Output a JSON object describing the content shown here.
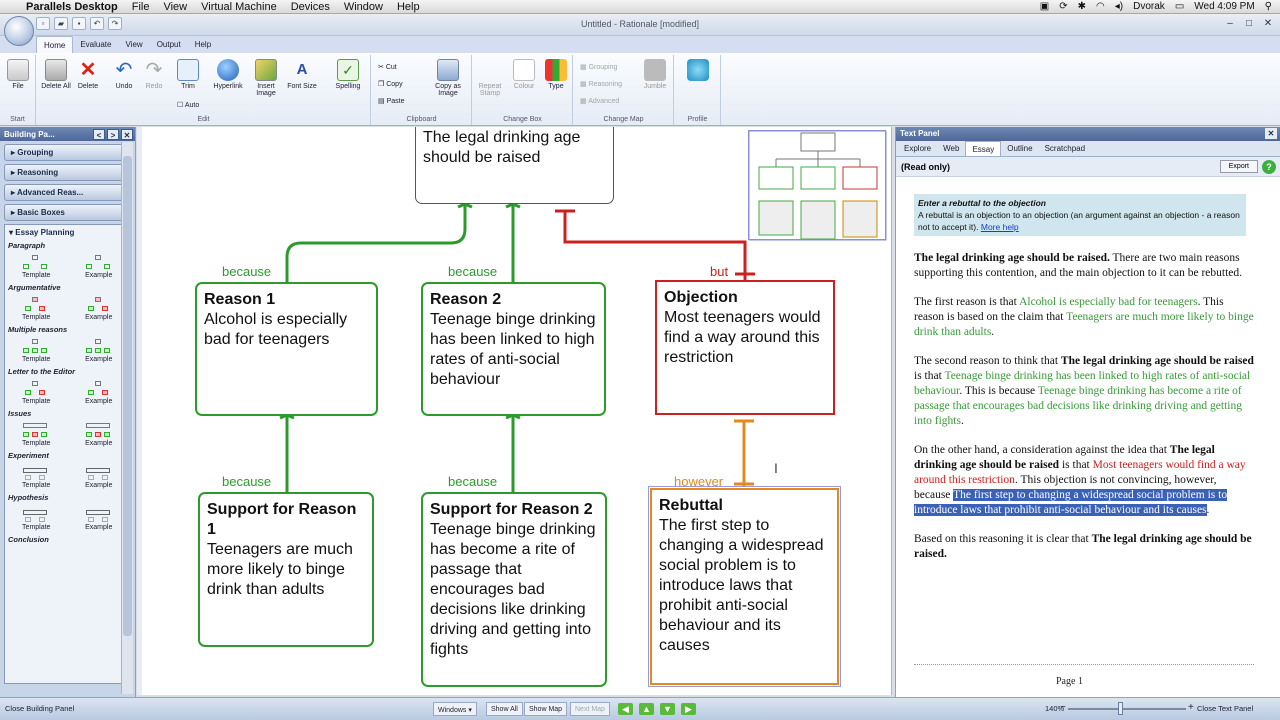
{
  "mac_menu": {
    "app": "Parallels Desktop",
    "items": [
      "File",
      "View",
      "Virtual Machine",
      "Devices",
      "Window",
      "Help"
    ],
    "user": "Dvorak",
    "clock": "Wed 4:09 PM"
  },
  "window": {
    "title": "Untitled - Rationale [modified]"
  },
  "ribbon_tabs": [
    "Home",
    "Evaluate",
    "View",
    "Output",
    "Help"
  ],
  "ribbon": {
    "start": {
      "label": "Start",
      "file": "File"
    },
    "edit": {
      "label": "Edit",
      "delete_all": "Delete All",
      "delete": "Delete",
      "undo": "Undo",
      "redo": "Redo",
      "trim": "Trim",
      "auto": "Auto",
      "hyperlink": "Hyperlink",
      "insert_image": "Insert Image",
      "font_size": "Font Size",
      "spelling": "Spelling"
    },
    "clipboard": {
      "label": "Clipboard",
      "cut": "Cut",
      "copy": "Copy",
      "paste": "Paste",
      "copy_as_image": "Copy as Image"
    },
    "change_box": {
      "label": "Change Box",
      "repeat_stamp": "Repeat Stamp",
      "colour": "Colour",
      "type": "Type"
    },
    "change_map": {
      "label": "Change Map",
      "grouping": "Grouping",
      "reasoning": "Reasoning",
      "advanced": "Advanced",
      "jumble": "Jumble"
    },
    "profile": {
      "label": "Profile"
    }
  },
  "building_panel": {
    "title": "Building Pa...",
    "categories": [
      "Grouping",
      "Reasoning",
      "Advanced Reas...",
      "Basic Boxes"
    ],
    "essay_planning": {
      "title": "Essay Planning",
      "sections": [
        "Paragraph",
        "Argumentative",
        "Multiple reasons",
        "Letter to the Editor",
        "Issues",
        "Experiment",
        "Hypothesis",
        "Conclusion"
      ],
      "template": "Template",
      "example": "Example"
    }
  },
  "map": {
    "contention": "The legal drinking age should be raised",
    "reason1": {
      "title": "Reason 1",
      "text": "Alcohol is especially bad for teenagers"
    },
    "reason2": {
      "title": "Reason 2",
      "text": "Teenage binge drinking has been linked to high rates of anti-social behaviour"
    },
    "objection": {
      "title": "Objection",
      "text": "Most teenagers would find a way around this restriction"
    },
    "support1": {
      "title": "Support for Reason 1",
      "text": "Teenagers are much more likely to binge drink than adults"
    },
    "support2": {
      "title": "Support for Reason 2",
      "text": "Teenage binge drinking has become a rite of passage that encourages bad decisions like drinking driving and getting into fights"
    },
    "rebuttal": {
      "title": "Rebuttal",
      "text": "The first step to changing a widespread social problem is to introduce laws that prohibit anti-social behaviour and its causes"
    },
    "because": "because",
    "but": "but",
    "however": "however",
    "cursor": "I"
  },
  "text_panel": {
    "title": "Text Panel",
    "tabs": [
      "Explore",
      "Web",
      "Essay",
      "Outline",
      "Scratchpad"
    ],
    "read_only": "(Read only)",
    "export": "Export",
    "help": "?",
    "hint_title": "Enter a rebuttal to the objection",
    "hint_text": "A rebuttal is an objection to an objection (an argument against an objection - a reason not to accept it).",
    "hint_link": "More help",
    "p1": {
      "c": "The legal drinking age should be raised.",
      "t": " There are two main reasons supporting this contention, and the main objection to it can be rebutted."
    },
    "p2": {
      "a": "The first reason is that ",
      "g1": "Alcohol is especially bad for teenagers",
      "b": ". This reason is based on the claim that ",
      "g2": "Teenagers are much more likely to binge drink than adults",
      "c": "."
    },
    "p3": {
      "a": "The second reason to think that ",
      "c": "The legal drinking age should be raised",
      "b": " is that ",
      "g1": "Teenage binge drinking has been linked to high rates of anti-social behaviour",
      "d": ". This is because ",
      "g2": "Teenage binge drinking has become a rite of passage that encourages bad decisions like drinking driving and getting into fights",
      "e": "."
    },
    "p4": {
      "a": "On the other hand, a consideration against the idea that ",
      "c": "The legal drinking age should be raised",
      "b": " is that ",
      "r": "Most teenagers would find a way around this restriction",
      "d": ". This objection is not convincing, however, because ",
      "s": "The first step to changing a widespread social problem is to introduce laws that prohibit anti-social behaviour and its causes",
      "e": "."
    },
    "p5": {
      "a": "Based on this reasoning it is clear that ",
      "c": "The legal drinking age should be raised."
    },
    "page": "Page 1"
  },
  "status_bar": {
    "close_building": "Close Building Panel",
    "windows": "Windows",
    "show_all": "Show All",
    "show_map": "Show Map",
    "next_map": "Next Map",
    "zoom": "140%",
    "close_text": "Close Text Panel"
  },
  "colors": {
    "green": "#3a9a3a",
    "red": "#cc2020",
    "orange": "#e08a20",
    "selection": "#3a61b6"
  }
}
